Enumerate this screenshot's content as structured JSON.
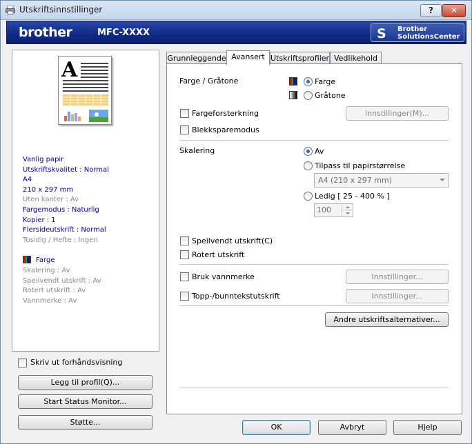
{
  "window": {
    "title": "Utskriftsinnstillinger",
    "help_label": "?",
    "close_label": "✕"
  },
  "banner": {
    "logo": "brother",
    "model": "MFC-XXXX",
    "solutions_line1": "Brother",
    "solutions_line2": "SolutionsCenter"
  },
  "preview": {
    "letter": "A"
  },
  "summary": {
    "paper": "Vanlig papir",
    "quality": "Utskriftskvalitet : Normal",
    "size": "A4",
    "dimensions": "210 x 297 mm",
    "borderless": "Uten kanter : Av",
    "color_mode": "Fargemodus : Naturlig",
    "copies": "Kopier : 1",
    "multipage": "Flersidеutskrift : Normal",
    "duplex": "Tosidig / Hefte : Ingen",
    "color": "Farge",
    "scaling": "Skalering : Av",
    "mirror": "Speilvendt utskrift : Av",
    "rotate": "Rotert utskrift : Av",
    "watermark": "Vannmerke : Av"
  },
  "left_controls": {
    "print_preview": "Skriv ut forhåndsvisning",
    "add_profile": "Legg til profil(Q)...",
    "status_monitor": "Start Status Monitor...",
    "support": "Støtte..."
  },
  "tabs": [
    {
      "label": "Grunnleggende"
    },
    {
      "label": "Avansert"
    },
    {
      "label": "Utskriftsprofiler"
    },
    {
      "label": "Vedlikehold"
    }
  ],
  "advanced": {
    "color_gray_label": "Farge / Gråtone",
    "color_option": "Farge",
    "gray_option": "Gråtone",
    "color_enhance": "Fargeforsterkning",
    "color_enhance_settings": "Innstillinger(M)...",
    "ink_save": "Blekksparemodus",
    "scaling_label": "Skalering",
    "scaling_off": "Av",
    "fit_to_paper": "Tilpass til papirstørrelse",
    "paper_size_value": "A4 (210 x 297 mm)",
    "free_scaling": "Ledig [ 25 - 400 % ]",
    "scaling_value": "100",
    "mirror_print": "Speilvendt utskrift(C)",
    "rotate_print": "Rotert utskrift",
    "use_watermark": "Bruk vannmerke",
    "watermark_settings": "Innstillinger...",
    "header_footer": "Topp-/bunntekstutskrift",
    "header_footer_settings": "Innstillinger...",
    "other_options": "Andre utskriftsalternativer..."
  },
  "footer": {
    "ok": "OK",
    "cancel": "Avbryt",
    "help": "Hjelp"
  }
}
